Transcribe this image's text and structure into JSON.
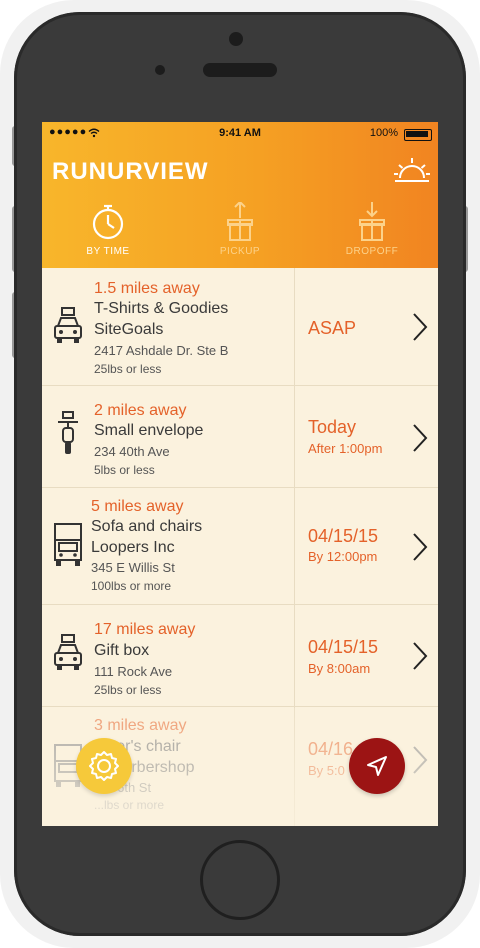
{
  "status_bar": {
    "carrier": "●●●●● ",
    "time": "9:41 AM",
    "battery": "100%"
  },
  "app": {
    "brand": "RUNURVIEW"
  },
  "tabs": [
    {
      "label": "BY TIME",
      "active": true
    },
    {
      "label": "PICKUP",
      "active": false
    },
    {
      "label": "DROPOFF",
      "active": false
    }
  ],
  "deliveries": [
    {
      "vehicle": "car-icon",
      "distance": "1.5 miles away",
      "title_lines": [
        "T-Shirts & Goodies",
        "SiteGoals"
      ],
      "address": "2417 Ashdale Dr. Ste B",
      "weight": "25lbs or less",
      "when_main": "ASAP",
      "when_sub": ""
    },
    {
      "vehicle": "scooter-icon",
      "distance": "2 miles away",
      "title_lines": [
        "Small envelope"
      ],
      "address": "234 40th Ave",
      "weight": "5lbs or less",
      "when_main": "Today",
      "when_sub": "After 1:00pm"
    },
    {
      "vehicle": "truck-icon",
      "distance": "5 miles away",
      "title_lines": [
        "Sofa and chairs",
        "Loopers Inc"
      ],
      "address": "345 E Willis St",
      "weight": "100lbs or more",
      "when_main": "04/15/15",
      "when_sub": "By 12:00pm"
    },
    {
      "vehicle": "car-icon",
      "distance": "17 miles away",
      "title_lines": [
        "Gift box"
      ],
      "address": "111 Rock Ave",
      "weight": "25lbs or less",
      "when_main": "04/15/15",
      "when_sub": "By 8:00am"
    },
    {
      "vehicle": "truck-icon",
      "distance": "3 miles away",
      "title_lines": [
        "...ber's chair",
        "... Barbershop"
      ],
      "address": "...E 6th St",
      "weight": "...lbs or more",
      "when_main": "04/16",
      "when_sub": "By 5:0"
    }
  ],
  "colors": {
    "accent": "#e4622a",
    "header_start": "#f8b62b",
    "header_end": "#f18421",
    "fab_settings": "#f6c93a",
    "fab_nav": "#9c1414",
    "list_bg": "#fbf2de"
  }
}
